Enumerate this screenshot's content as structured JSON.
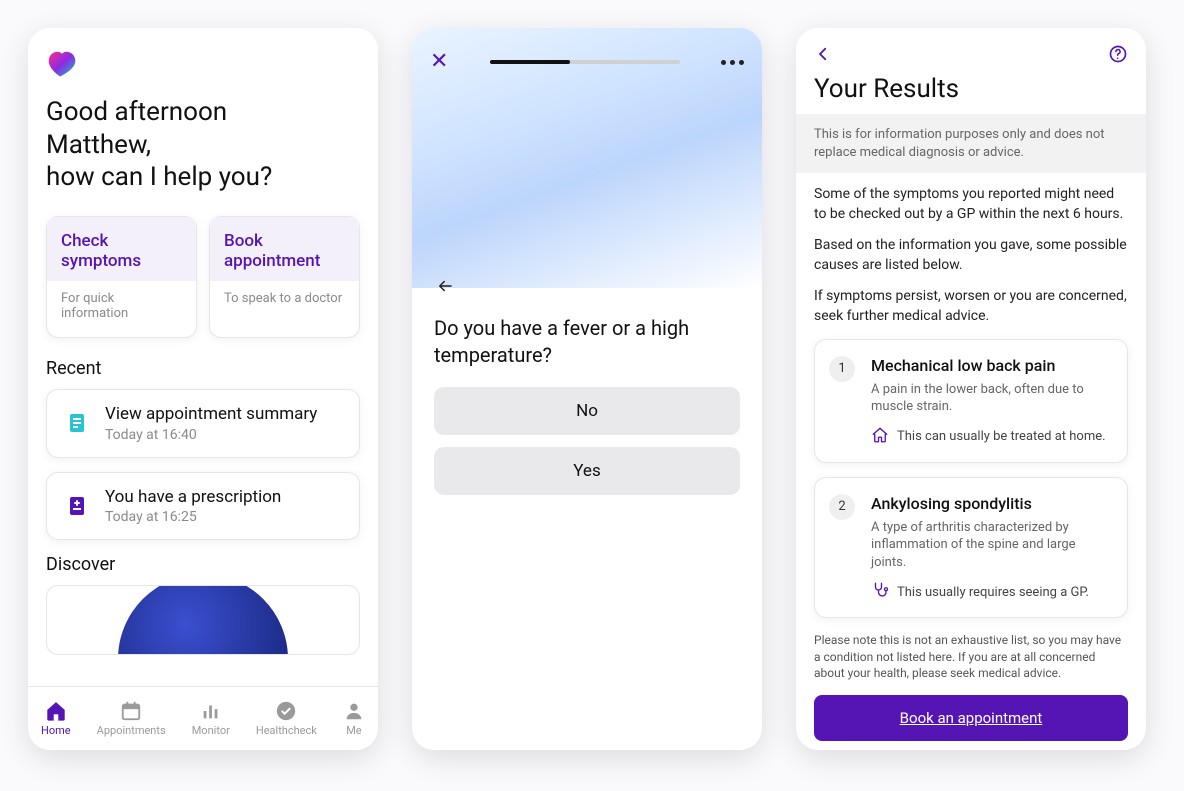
{
  "colors": {
    "purple": "#5514B4"
  },
  "screen1": {
    "greeting_line1": "Good afternoon",
    "greeting_line2": "Matthew,",
    "greeting_line3": "how can I help you?",
    "tiles": [
      {
        "title": "Check symptoms",
        "sub": "For quick information"
      },
      {
        "title": "Book appointment",
        "sub": "To speak to a doctor"
      }
    ],
    "recent_heading": "Recent",
    "recent": [
      {
        "title": "View appointment summary",
        "sub": "Today at 16:40",
        "icon": "document"
      },
      {
        "title": "You have a prescription",
        "sub": "Today at 16:25",
        "icon": "prescription"
      }
    ],
    "discover_heading": "Discover",
    "tabs": [
      {
        "label": "Home",
        "active": true
      },
      {
        "label": "Appointments",
        "active": false
      },
      {
        "label": "Monitor",
        "active": false
      },
      {
        "label": "Healthcheck",
        "active": false
      },
      {
        "label": "Me",
        "active": false
      }
    ]
  },
  "screen2": {
    "progress_pct": 42,
    "question": "Do you have a fever or a high temperature?",
    "answers": [
      "No",
      "Yes"
    ]
  },
  "screen3": {
    "title": "Your Results",
    "banner": "This is for information purposes only and does not replace medical diagnosis or advice.",
    "paras": [
      "Some of the symptoms you reported might need to be checked out by a GP within the next 6 hours.",
      "Based on the information you gave, some possible causes are listed below.",
      "If symptoms persist, worsen or you are concerned, seek further medical advice."
    ],
    "results": [
      {
        "num": "1",
        "title": "Mechanical low back pain",
        "sub": "A pain in the lower back, often due to muscle strain.",
        "foot": "This can usually be treated at home.",
        "footIcon": "home"
      },
      {
        "num": "2",
        "title": "Ankylosing spondylitis",
        "sub": "A type of arthritis characterized by inflammation of the spine and large joints.",
        "foot": "This usually requires seeing a GP.",
        "footIcon": "stethoscope"
      }
    ],
    "note": "Please note this is not an exhaustive list, so you may have a condition not listed here. If you are at all concerned about your health, please seek medical advice.",
    "cta": "Book an appointment"
  }
}
